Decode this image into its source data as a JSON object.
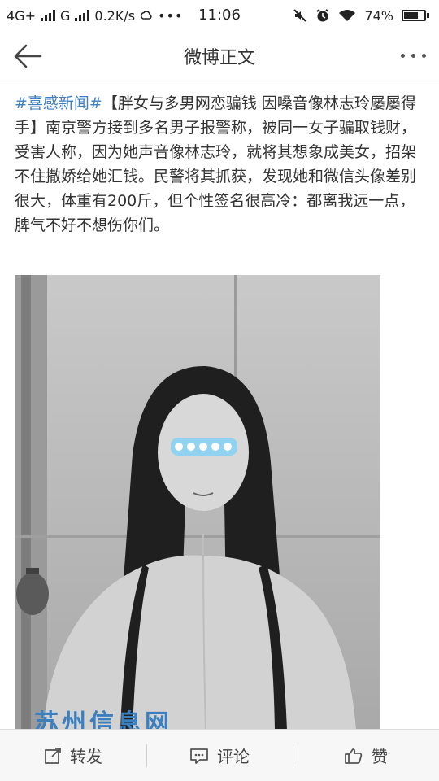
{
  "status_bar": {
    "network": "4G+",
    "carrier2": "G",
    "speed": "0.2K/s",
    "time": "11:06",
    "battery": "74%",
    "battery_level": 0.74
  },
  "nav": {
    "title": "微博正文",
    "icons": [
      "back-arrow-icon",
      "more-icon"
    ]
  },
  "post": {
    "hashtag": "#喜感新闻#",
    "text": "【胖女与多男网恋骗钱 因嗓音像林志玲屡屡得手】南京警方接到多名男子报警称，被同一女子骗取钱财，受害人称，因为她声音像林志玲，就将其想象成美女，招架不住撒娇给她汇钱。民警将其抓获，发现她和微信头像差别很大，体重有200斤，但个性签名很高冷：都离我远一点，脾气不好不想伤你们。"
  },
  "photo": {
    "watermark": "苏州信息网"
  },
  "actions": {
    "repost": "转发",
    "comment": "评论",
    "like": "赞"
  },
  "colors": {
    "hashtag": "#3f7fbf",
    "mosaic": "#8fd3f0"
  }
}
